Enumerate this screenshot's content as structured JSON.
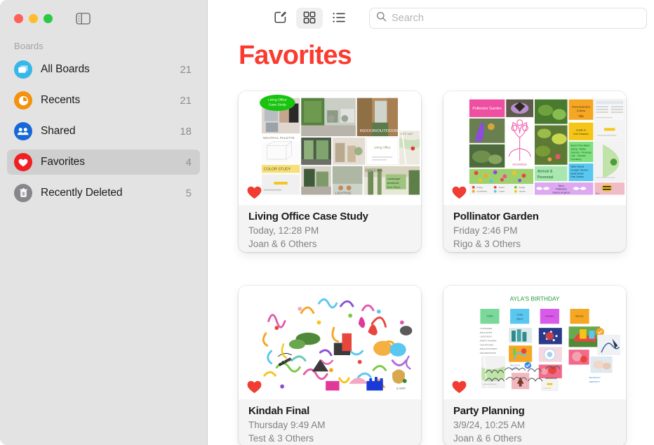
{
  "window": {
    "traffic_lights": [
      {
        "name": "close",
        "color": "#ff6159"
      },
      {
        "name": "minimize",
        "color": "#ffbd2e"
      },
      {
        "name": "zoom",
        "color": "#2acb42"
      }
    ],
    "sidebar_toggle_icon": "sidebar-toggle-icon"
  },
  "sidebar": {
    "header": "Boards",
    "items": [
      {
        "label": "All Boards",
        "count": "21",
        "icon": "boards-icon",
        "color": "#36b7e8",
        "selected": false
      },
      {
        "label": "Recents",
        "count": "21",
        "icon": "clock-icon",
        "color": "#f5910b",
        "selected": false
      },
      {
        "label": "Shared",
        "count": "18",
        "icon": "people-icon",
        "color": "#1667d8",
        "selected": false
      },
      {
        "label": "Favorites",
        "count": "4",
        "icon": "heart-icon",
        "color": "#ef1f24",
        "selected": true
      },
      {
        "label": "Recently Deleted",
        "count": "5",
        "icon": "trash-icon",
        "color": "#86868b",
        "selected": false
      }
    ]
  },
  "toolbar": {
    "buttons": [
      {
        "name": "new-board-button",
        "icon": "compose-icon",
        "active": false
      },
      {
        "name": "grid-view-button",
        "icon": "grid-icon",
        "active": true
      },
      {
        "name": "list-view-button",
        "icon": "list-icon",
        "active": false
      }
    ],
    "search": {
      "icon": "search-icon",
      "placeholder": "Search",
      "value": ""
    }
  },
  "main": {
    "title": "Favorites",
    "title_color": "#fb3b30",
    "boards": [
      {
        "title": "Living Office Case Study",
        "date": "Today, 12:28 PM",
        "participants": "Joan & 6 Others",
        "favorite": true,
        "thumbnail": "living-office-moodboard-thumbnail"
      },
      {
        "title": "Pollinator Garden",
        "date": "Friday 2:46 PM",
        "participants": "Rigo & 3 Others",
        "favorite": true,
        "thumbnail": "pollinator-garden-moodboard-thumbnail"
      },
      {
        "title": "Kindah Final",
        "date": "Thursday 9:49 AM",
        "participants": "Test & 3 Others",
        "favorite": true,
        "thumbnail": "kindah-doodles-thumbnail"
      },
      {
        "title": "Party Planning",
        "date": "3/9/24, 10:25 AM",
        "participants": "Joan & 6 Others",
        "favorite": true,
        "thumbnail": "party-planning-board-thumbnail"
      }
    ]
  }
}
